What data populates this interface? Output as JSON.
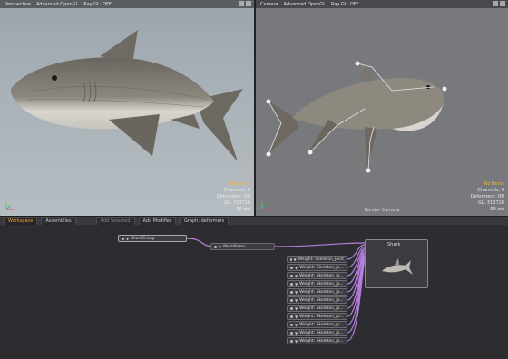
{
  "viewports": {
    "left": {
      "tabs": [
        "Perspective",
        "Advanced OpenGL",
        "Ray GL: OFF"
      ],
      "info": {
        "warn": "No Items",
        "lines": [
          "Channels: 0",
          "Deformers: ON",
          "GL: 313728",
          "20 cm"
        ]
      }
    },
    "right": {
      "tabs": [
        "Camera",
        "Advanced OpenGL",
        "Ray GL: OFF"
      ],
      "info": {
        "warn": "No Items",
        "lines": [
          "Channels: 0",
          "Deformers: ON",
          "GL: 313728",
          "50 cm"
        ]
      },
      "footer": "Render Camera"
    }
  },
  "tabbar": [
    "Workspace",
    "Assemblies",
    "Add Selected",
    "Add Modifier",
    "Graph: deformers"
  ],
  "graph": {
    "group_node": "SharkGroup",
    "mesh_node": "MeshItems",
    "shark_node": "Shark",
    "weight_nodes": [
      "Weight: Skeleton_Joint",
      "Weight: Skeleton_Jo...",
      "Weight: Skeleton_Jo...",
      "Weight: Skeleton_Jo...",
      "Weight: Skeleton_Jo...",
      "Weight: Skeleton_Jo...",
      "Weight: Skeleton_Jo...",
      "Weight: Skeleton_Jo...",
      "Weight: Skeleton_Jo...",
      "Weight: Skeleton_Jo...",
      "Weight: Skeleton_Jo..."
    ]
  },
  "colors": {
    "accent": "#f0a030",
    "wire": "#b77fe0"
  }
}
